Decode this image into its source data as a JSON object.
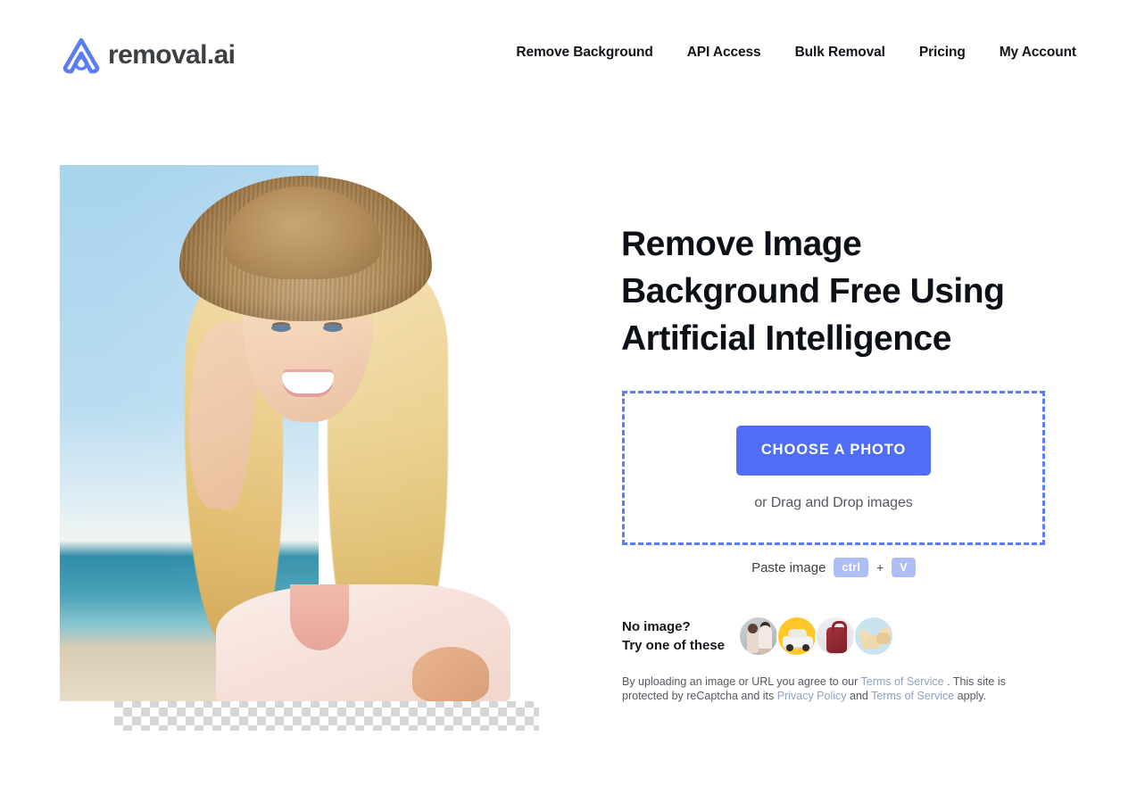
{
  "header": {
    "logo_icon": "removal-ai-logo-icon",
    "brand_name": "removal.ai",
    "brand_color": "#5b7cf5",
    "nav_items": [
      {
        "label": "Remove Background"
      },
      {
        "label": "API Access"
      },
      {
        "label": "Bulk Removal"
      },
      {
        "label": "Pricing"
      },
      {
        "label": "My Account"
      }
    ]
  },
  "hero": {
    "alt": "Before and after background removal preview of a smiling blonde woman wearing a straw hat at the beach",
    "before_description": "Original photo with blue sky and sea background",
    "after_description": "Transparent checkerboard background after removal"
  },
  "main": {
    "headline": "Remove Image Background Free Using Artificial Intelligence",
    "dropzone": {
      "button_label": "CHOOSE A PHOTO",
      "button_color": "#4f6ef5",
      "border_color": "#5b7cf5",
      "drag_text": "or Drag and Drop images"
    },
    "paste": {
      "label": "Paste image",
      "key1": "ctrl",
      "plus": "+",
      "key2": "V",
      "key_bg": "#aebdf4"
    },
    "samples": {
      "line1": "No image?",
      "line2": "Try one of these",
      "thumbs": [
        {
          "name": "sample-couple",
          "bg": "#aab0b6"
        },
        {
          "name": "sample-car",
          "bg": "#ffc727"
        },
        {
          "name": "sample-backpack",
          "bg": "#dfe2e5"
        },
        {
          "name": "sample-dogs",
          "bg": "#c9e3ef"
        }
      ]
    },
    "legal": {
      "part1": "By uploading an image or URL you agree to our ",
      "link1": "Terms of Service",
      "part2": " . This site is protected by reCaptcha and its ",
      "link2": "Privacy Policy",
      "part3": " and ",
      "link3": "Terms of Service",
      "part4": " apply."
    }
  }
}
